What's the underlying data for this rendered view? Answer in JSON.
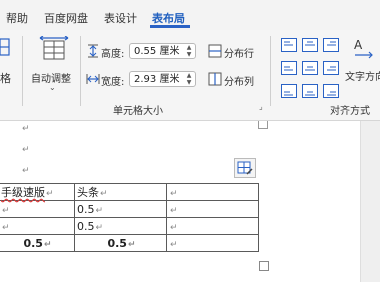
{
  "tabs": [
    {
      "label": "帮助",
      "active": false
    },
    {
      "label": "百度网盘",
      "active": false
    },
    {
      "label": "表设计",
      "active": false
    },
    {
      "label": "表布局",
      "active": true
    }
  ],
  "ribbon": {
    "partial_label": "格",
    "autofit_label": "自动调整",
    "height_label": "高度:",
    "height_value": "0.55 厘米",
    "width_label": "宽度:",
    "width_value": "2.93 厘米",
    "distribute_rows": "分布行",
    "distribute_cols": "分布列",
    "cell_size_group": "单元格大小",
    "text_direction": "文字方向",
    "alignment_group": "对齐方式"
  },
  "doc": {
    "paragraph_mark": "↵",
    "table": [
      [
        "手级速版",
        "头条",
        ""
      ],
      [
        "",
        "0.5",
        ""
      ],
      [
        "",
        "0.5",
        ""
      ],
      [
        "0.5",
        "0.5",
        ""
      ]
    ]
  },
  "colors": {
    "accent": "#2a62c5",
    "active_tab": "#1f5fbf",
    "ribbon_bg": "#f5f5f5"
  }
}
